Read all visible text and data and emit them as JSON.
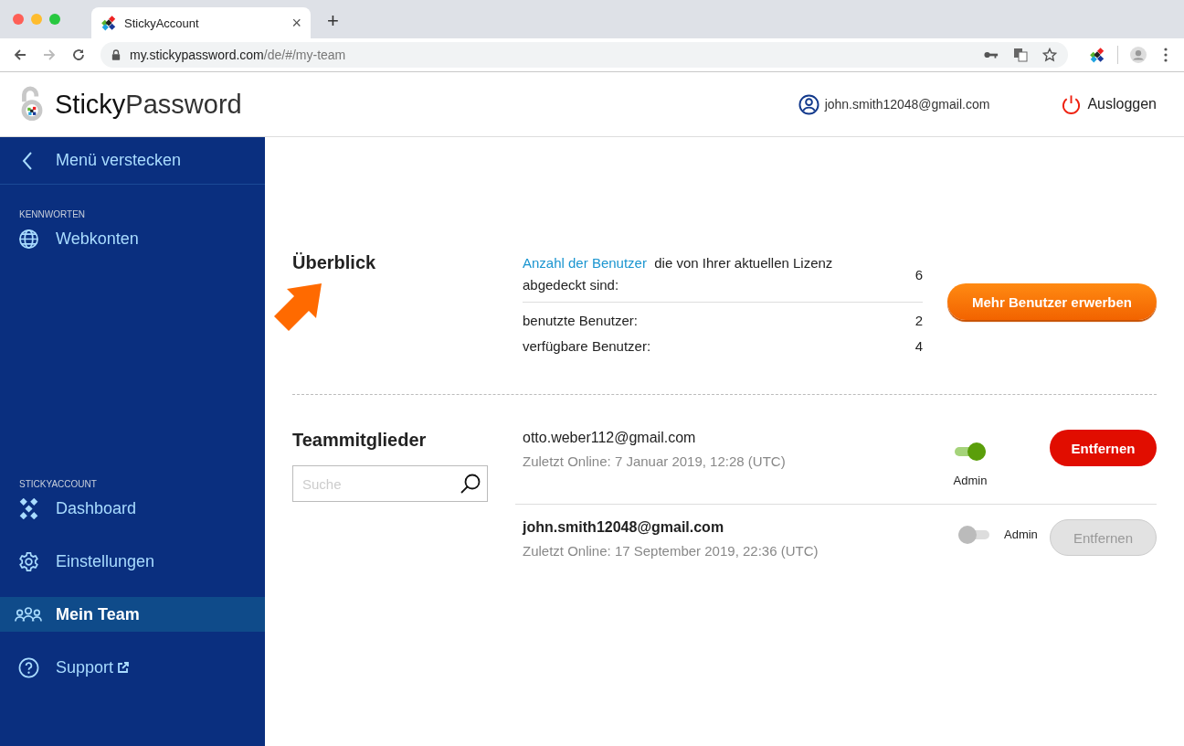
{
  "browser": {
    "tab": {
      "title": "StickyAccount",
      "close": "×"
    },
    "new_tab": "+",
    "url": {
      "host": "my.stickypassword.com",
      "path": "/de/#/my-team"
    }
  },
  "header": {
    "logo": {
      "bold": "Sticky",
      "light": "Password"
    },
    "user": "john.smith12048@gmail.com",
    "logout": "Ausloggen"
  },
  "sidebar": {
    "hide": "Menü verstecken",
    "sections": [
      {
        "heading": "KENNWORTEN",
        "items": [
          {
            "label": "Webkonten",
            "selected": false
          }
        ]
      },
      {
        "heading": "STICKYACCOUNT",
        "items": [
          {
            "label": "Dashboard",
            "selected": false
          },
          {
            "label": "Einstellungen",
            "selected": false
          },
          {
            "label": "Mein Team",
            "selected": true
          },
          {
            "label": "Support",
            "selected": false
          }
        ]
      }
    ]
  },
  "overview": {
    "title": "Überblick",
    "license_link": "Anzahl der Benutzer",
    "license_text": "die von Ihrer aktuellen Lizenz abgedeckt sind:",
    "license_value": "6",
    "stats": [
      {
        "label": "benutzte Benutzer:",
        "value": "2"
      },
      {
        "label": "verfügbare Benutzer:",
        "value": "4"
      }
    ],
    "buy_button": "Mehr Benutzer erwerben"
  },
  "team": {
    "title": "Teammitglieder",
    "search": {
      "placeholder": "Suche"
    },
    "members": [
      {
        "kind": "member",
        "email": "otto.weber112@gmail.com",
        "last_online": "Zuletzt Online: 7 Januar 2019, 12:28 (UTC)",
        "admin_label": "Admin",
        "admin_on": true,
        "remove": "Entfernen",
        "disabled": false
      },
      {
        "kind": "self",
        "email": "john.smith12048@gmail.com",
        "last_online": "Zuletzt Online: 17 September 2019, 22:36 (UTC)",
        "admin_label": "Admin",
        "admin_on": false,
        "remove": "Entfernen",
        "disabled": true
      }
    ]
  }
}
